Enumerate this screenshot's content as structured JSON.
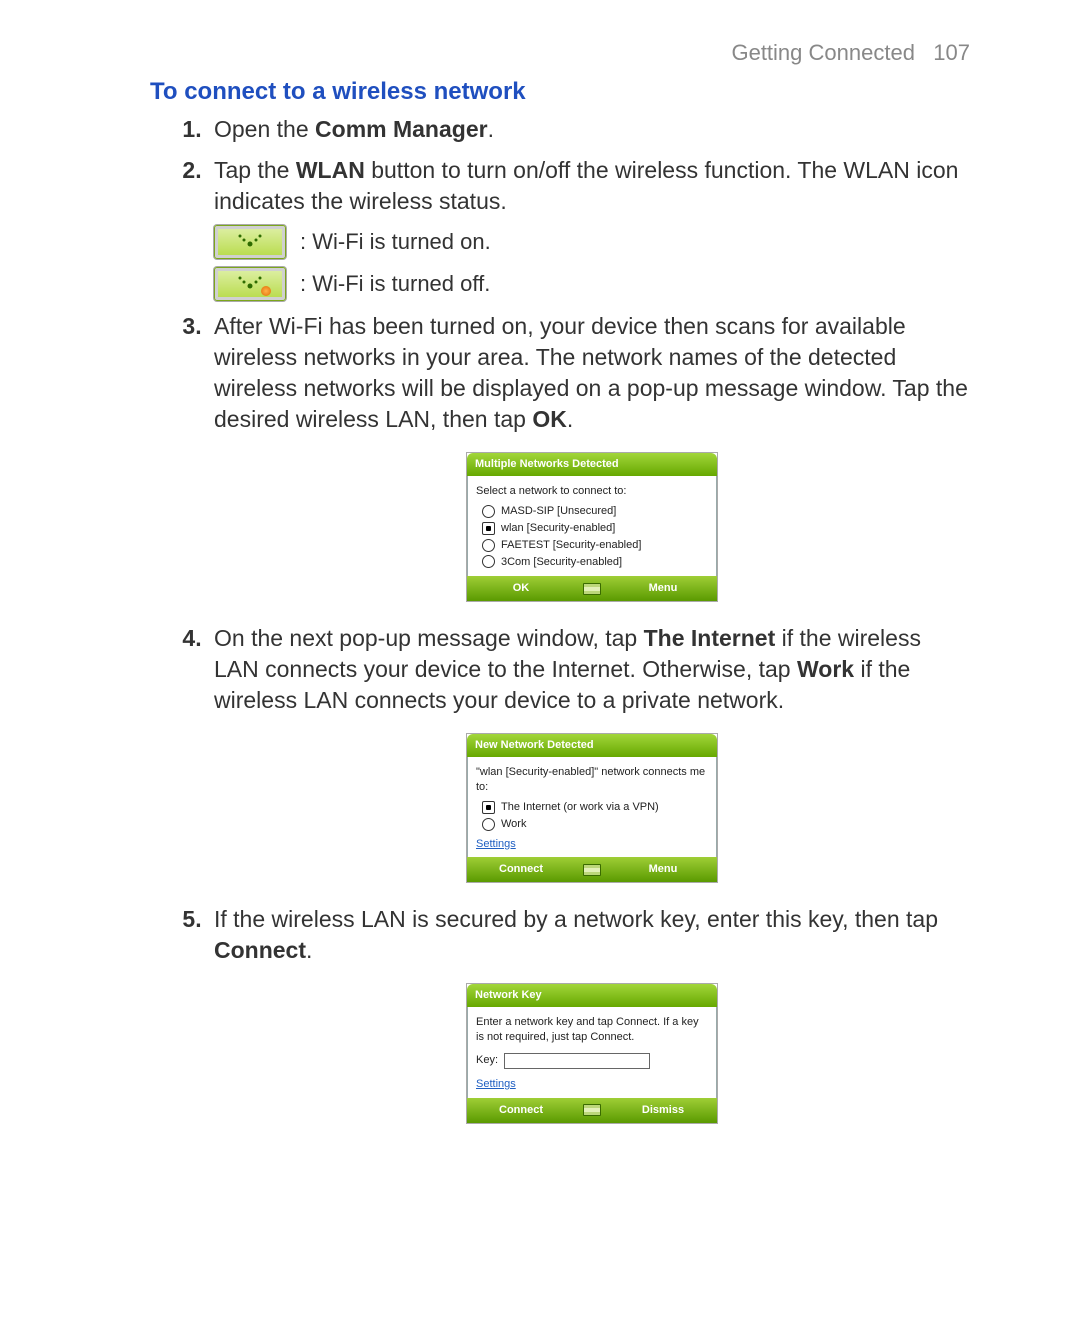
{
  "header": {
    "section": "Getting Connected",
    "page": "107"
  },
  "title": "To connect to a wireless network",
  "steps": {
    "s1": {
      "num": "1.",
      "pre": "Open the ",
      "bold": "Comm Manager",
      "post": "."
    },
    "s2": {
      "num": "2.",
      "pre": "Tap the ",
      "bold": "WLAN",
      "post": " button to turn on/off the wireless function. The WLAN icon indicates the wireless status."
    },
    "status_on": ": Wi-Fi is turned on.",
    "status_off": ": Wi-Fi is turned off.",
    "s3": {
      "num": "3.",
      "text_a": "After Wi-Fi has been turned on, your device then scans for available wireless networks in your area. The network names of the detected wireless networks will be displayed on a pop-up message window. Tap the desired wireless LAN, then tap ",
      "bold": "OK",
      "text_b": "."
    },
    "s4": {
      "num": "4.",
      "a": "On the next pop-up message window, tap ",
      "b1": "The Internet",
      "c": " if the wireless LAN connects your device to the Internet. Otherwise, tap ",
      "b2": "Work",
      "d": " if the wireless LAN connects your device to a private network."
    },
    "s5": {
      "num": "5.",
      "a": "If the wireless LAN is secured by a network key, enter this key, then tap ",
      "b": "Connect",
      "c": "."
    }
  },
  "popup1": {
    "title": "Multiple Networks Detected",
    "prompt": "Select a network to connect to:",
    "items": [
      {
        "label": "MASD-SIP [Unsecured]",
        "selected": false
      },
      {
        "label": "wlan [Security-enabled]",
        "selected": true
      },
      {
        "label": "FAETEST [Security-enabled]",
        "selected": false
      },
      {
        "label": "3Com [Security-enabled]",
        "selected": false
      }
    ],
    "left": "OK",
    "right": "Menu"
  },
  "popup2": {
    "title": "New Network Detected",
    "prompt": "\"wlan [Security-enabled]\" network connects me to:",
    "items": [
      {
        "label": "The Internet (or work via a VPN)",
        "selected": true
      },
      {
        "label": "Work",
        "selected": false
      }
    ],
    "settings": "Settings",
    "left": "Connect",
    "right": "Menu"
  },
  "popup3": {
    "title": "Network Key",
    "prompt": "Enter a network key and tap Connect. If a key is not required, just tap Connect.",
    "key_label": "Key:",
    "key_value": "",
    "settings": "Settings",
    "left": "Connect",
    "right": "Dismiss"
  }
}
